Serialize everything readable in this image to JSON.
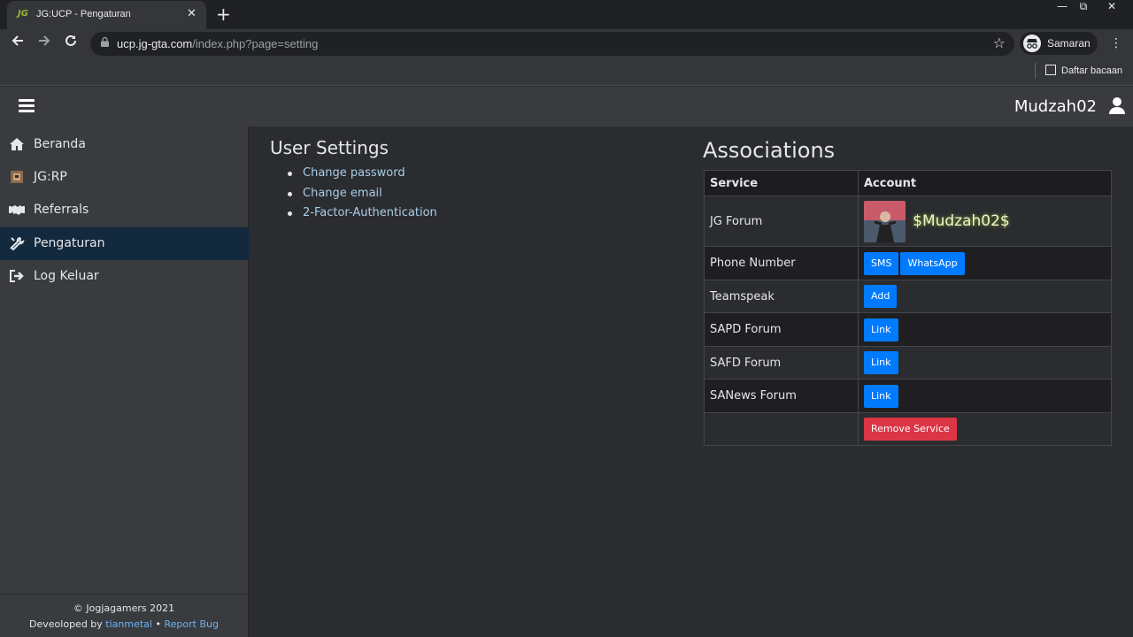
{
  "browser": {
    "tab_title": "JG:UCP - Pengaturan",
    "favicon_text": "JG",
    "tab_close": "✕",
    "new_tab": "+",
    "url_host": "ucp.jg-gta.com",
    "url_path": "/index.php?page=setting",
    "profile_label": "Samaran",
    "reading_list": "Daftar bacaan",
    "win_min": "—",
    "win_restore": "⧉",
    "win_close": "✕"
  },
  "header": {
    "username": "Mudzah02"
  },
  "sidebar": {
    "items": [
      {
        "label": "Beranda",
        "icon": "home-icon"
      },
      {
        "label": "JG:RP",
        "icon": "jgrp-icon"
      },
      {
        "label": "Referrals",
        "icon": "handshake-icon"
      },
      {
        "label": "Pengaturan",
        "icon": "tools-icon",
        "active": true
      },
      {
        "label": "Log Keluar",
        "icon": "sign-out-icon"
      }
    ],
    "footer": {
      "copyright": "© Jogjagamers 2021",
      "developed_prefix": "Deveoloped by",
      "developer": "tianmetal",
      "separator": "•",
      "report_bug": "Report Bug"
    }
  },
  "settings": {
    "title": "User Settings",
    "links": [
      "Change password",
      "Change email",
      "2-Factor-Authentication"
    ]
  },
  "associations": {
    "title": "Associations",
    "col_service": "Service",
    "col_account": "Account",
    "rows": [
      {
        "service": "JG Forum",
        "account_name": "$Mudzah02$"
      },
      {
        "service": "Phone Number",
        "buttons": [
          "SMS",
          "WhatsApp"
        ]
      },
      {
        "service": "Teamspeak",
        "buttons": [
          "Add"
        ]
      },
      {
        "service": "SAPD Forum",
        "buttons": [
          "Link"
        ]
      },
      {
        "service": "SAFD Forum",
        "buttons": [
          "Link"
        ]
      },
      {
        "service": "SANews Forum",
        "buttons": [
          "Link"
        ]
      }
    ],
    "remove_label": "Remove Service"
  },
  "colors": {
    "primary_button": "#007bff",
    "danger_button": "#dc3545",
    "active_nav": "#13293d",
    "link_color": "#a8cde8"
  }
}
